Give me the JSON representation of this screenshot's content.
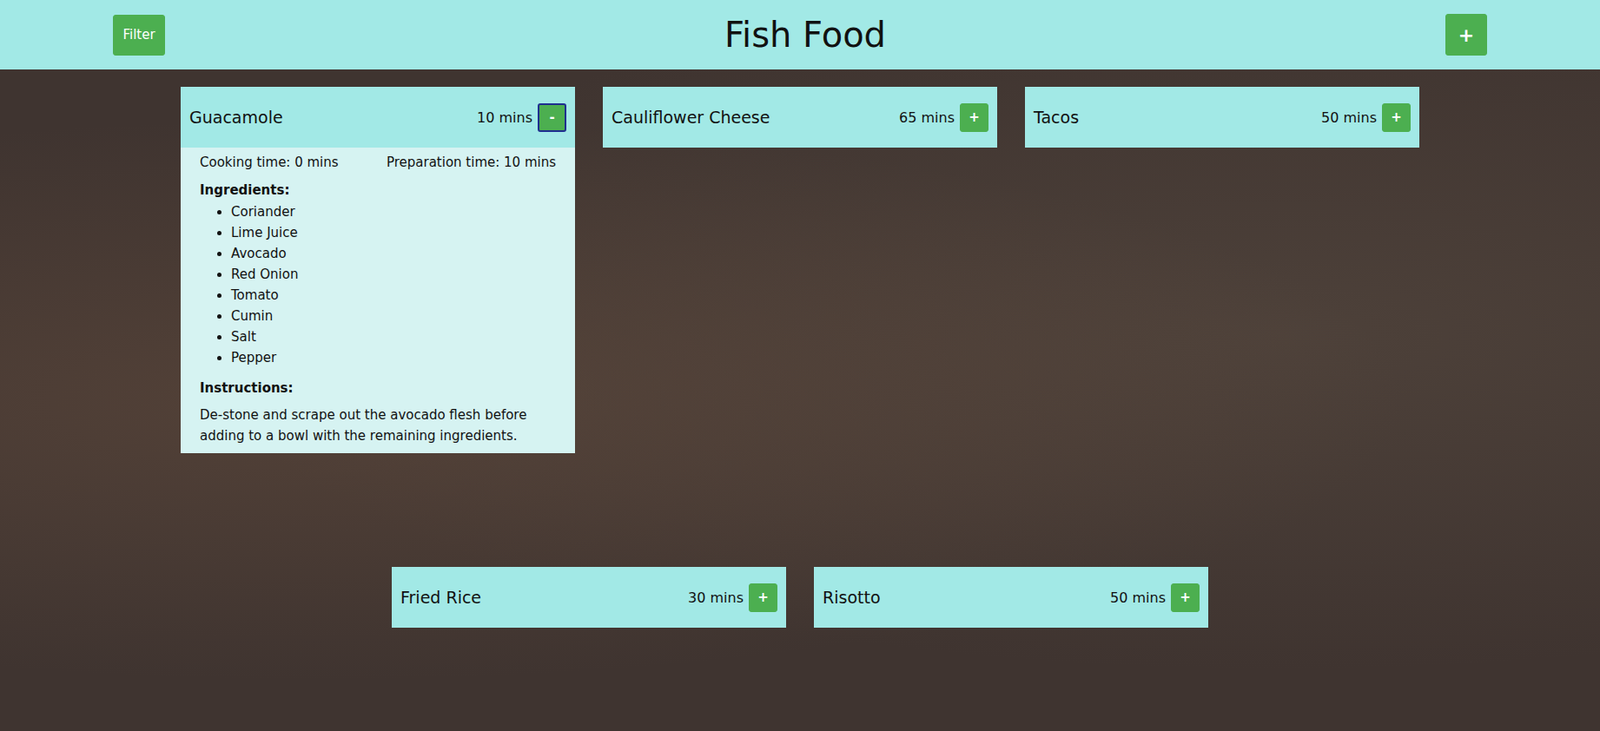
{
  "header": {
    "title": "Fish Food",
    "filter_button": "Filter",
    "add_button": "+"
  },
  "recipes": [
    {
      "name": "Guacamole",
      "time": "10 mins",
      "button": "-",
      "expanded": true,
      "focused": true,
      "details": {
        "cooking_time": "Cooking time: 0 mins",
        "preparation_time": "Preparation time: 10 mins",
        "ingredients_heading": "Ingredients:",
        "ingredients": [
          "Coriander",
          "Lime Juice",
          "Avocado",
          "Red Onion",
          "Tomato",
          "Cumin",
          "Salt",
          "Pepper"
        ],
        "instructions_heading": "Instructions:",
        "instructions": "De-stone and scrape out the avocado flesh before adding to a bowl with the remaining ingredients."
      }
    },
    {
      "name": "Cauliflower Cheese",
      "time": "65 mins",
      "button": "+",
      "expanded": false,
      "focused": false
    },
    {
      "name": "Tacos",
      "time": "50 mins",
      "button": "+",
      "expanded": false,
      "focused": false
    },
    {
      "name": "Fried Rice",
      "time": "30 mins",
      "button": "+",
      "expanded": false,
      "focused": false
    },
    {
      "name": "Risotto",
      "time": "50 mins",
      "button": "+",
      "expanded": false,
      "focused": false
    }
  ]
}
